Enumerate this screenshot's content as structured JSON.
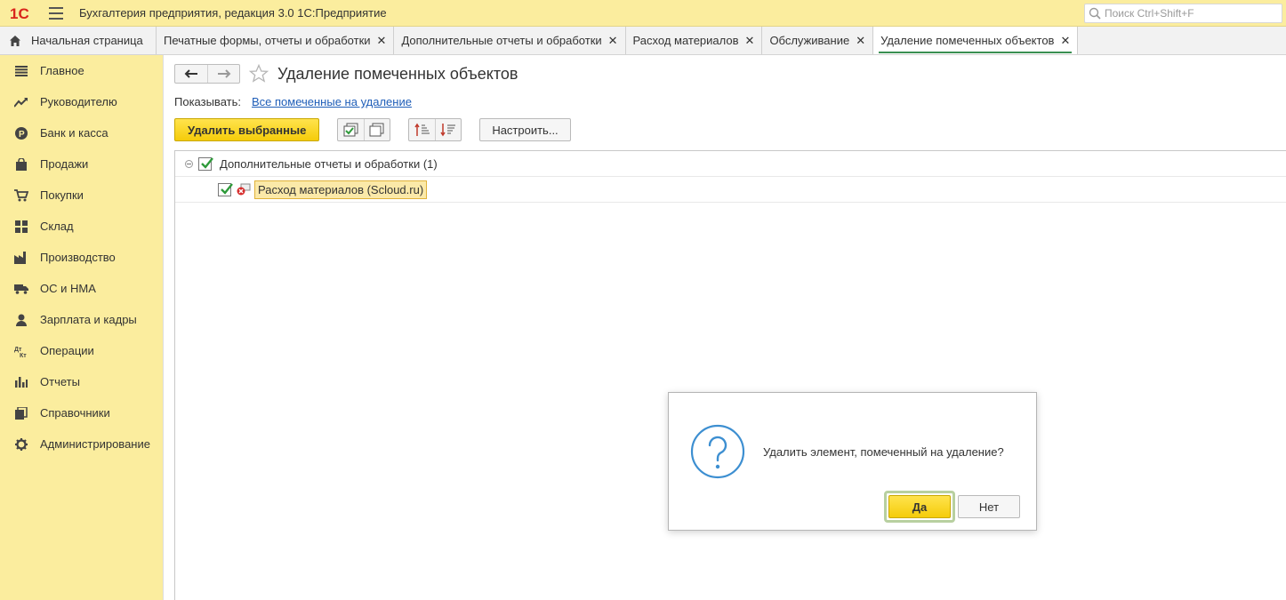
{
  "titlebar": {
    "logo_text": "1С",
    "app_title": "Бухгалтерия предприятия, редакция 3.0 1С:Предприятие",
    "search_placeholder": "Поиск Ctrl+Shift+F"
  },
  "tabs": [
    {
      "label": "Начальная страница",
      "closable": false
    },
    {
      "label": "Печатные формы, отчеты и обработки",
      "closable": true
    },
    {
      "label": "Дополнительные отчеты и обработки",
      "closable": true
    },
    {
      "label": "Расход материалов",
      "closable": true
    },
    {
      "label": "Обслуживание",
      "closable": true
    },
    {
      "label": "Удаление помеченных объектов",
      "closable": true,
      "active": true
    }
  ],
  "tab_close_glyph": "✕",
  "sidebar": {
    "items": [
      {
        "label": "Главное",
        "icon": "list-icon"
      },
      {
        "label": "Руководителю",
        "icon": "trend-icon"
      },
      {
        "label": "Банк и касса",
        "icon": "ruble-icon"
      },
      {
        "label": "Продажи",
        "icon": "bag-icon"
      },
      {
        "label": "Покупки",
        "icon": "cart-icon"
      },
      {
        "label": "Склад",
        "icon": "grid-icon"
      },
      {
        "label": "Производство",
        "icon": "factory-icon"
      },
      {
        "label": "ОС и НМА",
        "icon": "truck-icon"
      },
      {
        "label": "Зарплата и кадры",
        "icon": "person-icon"
      },
      {
        "label": "Операции",
        "icon": "dt-kt-icon"
      },
      {
        "label": "Отчеты",
        "icon": "bar-chart-icon"
      },
      {
        "label": "Справочники",
        "icon": "books-icon"
      },
      {
        "label": "Администрирование",
        "icon": "gear-icon"
      }
    ]
  },
  "main": {
    "page_title": "Удаление помеченных объектов",
    "show_label": "Показывать:",
    "show_link": "Все помеченные на удаление",
    "delete_selected_label": "Удалить выбранные",
    "settings_label": "Настроить...",
    "tree": {
      "group_label": "Дополнительные отчеты и обработки (1)",
      "item_label": "Расход материалов (Scloud.ru)"
    }
  },
  "dialog": {
    "message": "Удалить элемент, помеченный на удаление?",
    "yes_label": "Да",
    "no_label": "Нет"
  },
  "colors": {
    "accent_yellow": "#fbed9e",
    "button_yellow": "#f5cc0a",
    "link_blue": "#1f5eb8",
    "active_tab_underline": "#3a8f52",
    "question_blue": "#3d8fd1",
    "check_green": "#2e9a3a"
  }
}
